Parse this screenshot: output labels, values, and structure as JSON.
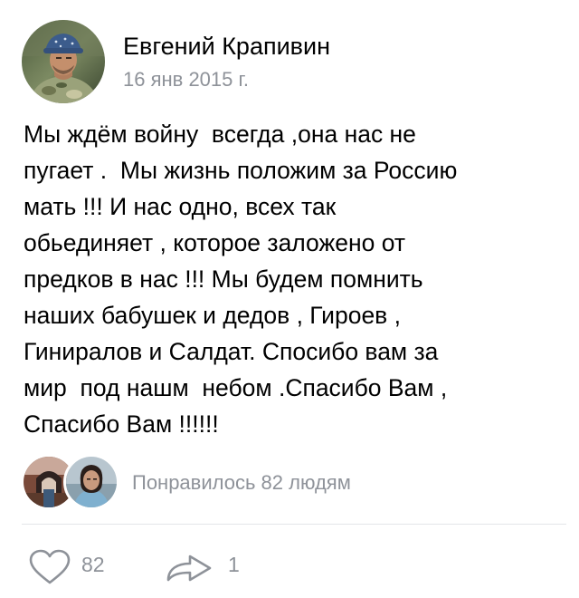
{
  "post": {
    "author_name": "Евгений Крапивин",
    "date": "16 янв 2015 г.",
    "text_lines": [
      "Мы ждём войну  всегда ,она нас не",
      "пугает .  Мы жизнь положим за Россию",
      "мать !!! И нас одно, всех так",
      "обьединяет , которое заложено от",
      "предков в нас !!! Мы будем помнить",
      "наших бабушек и дедов , Гироев ,",
      "Гиниралов и Салдат. Спосибо вам за",
      "мир  под нашм  небом .Спасибо Вам ,",
      "Спасибо Вам !!!!!!"
    ]
  },
  "likes": {
    "summary": "Понравилось 82 людям"
  },
  "actions": {
    "like_count": "82",
    "share_count": "1",
    "like_icon": "heart-outline-icon",
    "share_icon": "share-arrow-icon"
  },
  "colors": {
    "text": "#000000",
    "secondary": "#8e9299",
    "icon": "#8e9299",
    "divider": "#e3e5e8",
    "background": "#ffffff"
  }
}
